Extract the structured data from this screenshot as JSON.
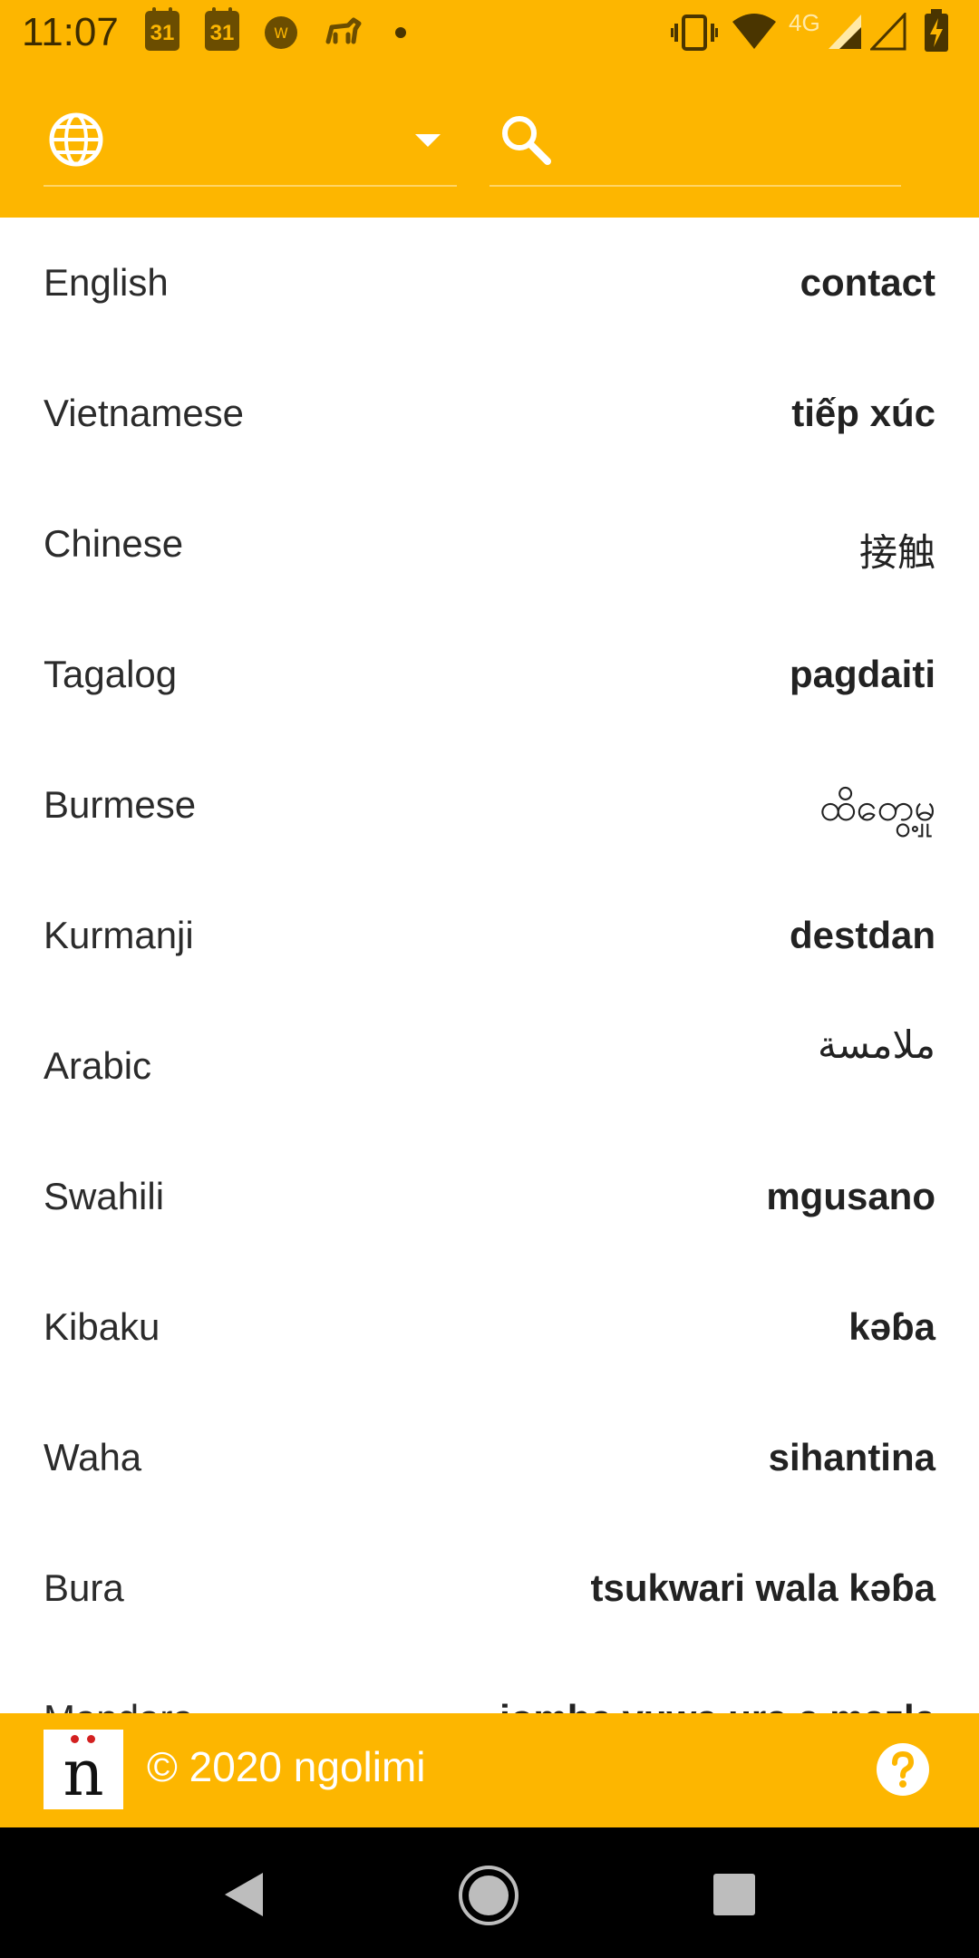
{
  "status_bar": {
    "time": "11:07",
    "calendar_day_1": "31",
    "calendar_day_2": "31",
    "network": "4G",
    "icons": [
      "calendar-icon",
      "calendar-icon",
      "app-icon",
      "animal-icon",
      "dot-icon",
      "vibrate-icon",
      "wifi-icon",
      "signal-icon",
      "signal-icon",
      "battery-charging-icon"
    ]
  },
  "toolbar": {
    "language_select": {
      "icon": "globe-icon",
      "value": ""
    },
    "search": {
      "icon": "search-icon",
      "placeholder": ""
    }
  },
  "rows": [
    {
      "language": "English",
      "word": "contact"
    },
    {
      "language": "Vietnamese",
      "word": "tiếp xúc"
    },
    {
      "language": "Chinese",
      "word": "接触"
    },
    {
      "language": "Tagalog",
      "word": "pagdaiti"
    },
    {
      "language": "Burmese",
      "word": "ထိတွေ့မှု"
    },
    {
      "language": "Kurmanji",
      "word": "destdan"
    },
    {
      "language": "Arabic",
      "word": "ملامسة"
    },
    {
      "language": "Swahili",
      "word": "mgusano"
    },
    {
      "language": "Kibaku",
      "word": "kəɓa"
    },
    {
      "language": "Waha",
      "word": "sihantina"
    },
    {
      "language": "Bura",
      "word": "tsukwari wala kəɓa"
    },
    {
      "language": "Mandara",
      "word": "iomba yuwa ura a mazla"
    }
  ],
  "footer": {
    "logo_letter": "n",
    "copyright": "© 2020 ngolimi",
    "help_icon": "help-icon"
  },
  "navbar": {
    "icons": [
      "back-icon",
      "home-icon",
      "recents-icon"
    ]
  },
  "colors": {
    "accent": "#FDB600",
    "text": "#2b2b2b",
    "navbar": "#000000"
  }
}
